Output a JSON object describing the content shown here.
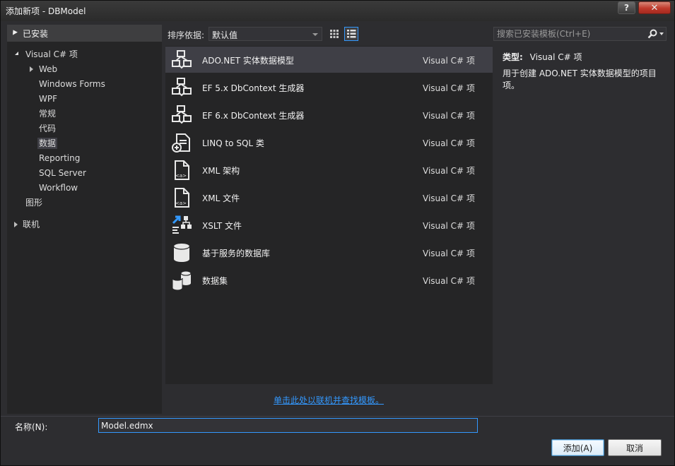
{
  "window": {
    "title": "添加新项 - DBModel",
    "help_label": "?",
    "close_label": "✕"
  },
  "left": {
    "header": "已安装",
    "tree": [
      {
        "label": "Visual C# 项"
      },
      {
        "label": "Web"
      },
      {
        "label": "Windows Forms"
      },
      {
        "label": "WPF"
      },
      {
        "label": "常规"
      },
      {
        "label": "代码"
      },
      {
        "label": "数据"
      },
      {
        "label": "Reporting"
      },
      {
        "label": "SQL Server"
      },
      {
        "label": "Workflow"
      },
      {
        "label": "图形"
      },
      {
        "label": "联机"
      }
    ],
    "selected": "数据"
  },
  "toolbar": {
    "sort_label": "排序依据:",
    "sort_value": "默认值",
    "search_placeholder": "搜索已安装模板(Ctrl+E)"
  },
  "items": [
    {
      "name": "ADO.NET 实体数据模型",
      "category": "Visual C# 项",
      "icon": "entity-model-icon"
    },
    {
      "name": "EF 5.x DbContext 生成器",
      "category": "Visual C# 项",
      "icon": "entity-model-icon"
    },
    {
      "name": "EF 6.x DbContext 生成器",
      "category": "Visual C# 项",
      "icon": "entity-model-icon"
    },
    {
      "name": "LINQ to SQL 类",
      "category": "Visual C# 项",
      "icon": "linq-icon"
    },
    {
      "name": "XML 架构",
      "category": "Visual C# 项",
      "icon": "xml-file-icon"
    },
    {
      "name": "XML 文件",
      "category": "Visual C# 项",
      "icon": "xml-file-icon"
    },
    {
      "name": "XSLT 文件",
      "category": "Visual C# 项",
      "icon": "xslt-icon"
    },
    {
      "name": "基于服务的数据库",
      "category": "Visual C# 项",
      "icon": "database-icon"
    },
    {
      "name": "数据集",
      "category": "Visual C# 项",
      "icon": "dataset-icon"
    }
  ],
  "details": {
    "type_label": "类型:",
    "type_value": "Visual C# 项",
    "description": "用于创建 ADO.NET 实体数据模型的项目项。"
  },
  "online_link": "单击此处以联机并查找模板。",
  "bottom": {
    "name_label": "名称(N):",
    "name_value": "Model.edmx",
    "add_button": "添加(A)",
    "cancel_button": "取消"
  },
  "colors": {
    "accent": "#3399ff",
    "panel": "#252526",
    "selection": "#3f3f46",
    "background": "#2d2d30"
  }
}
